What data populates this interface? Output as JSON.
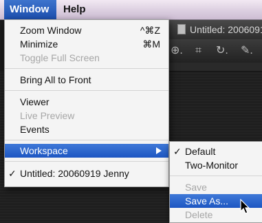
{
  "menubar": {
    "items": [
      {
        "label": "Window"
      },
      {
        "label": "Help"
      }
    ]
  },
  "background_window": {
    "title": "Untitled: 2006091",
    "toolbar_icons": [
      "zoom-icon",
      "crop-icon",
      "rotate-icon",
      "brush-icon"
    ],
    "toolbar_glyphs": [
      "⊕.",
      "⌗",
      "↻.",
      "✎."
    ]
  },
  "window_menu": {
    "items": [
      {
        "label": "Zoom Window",
        "shortcut": "^⌘Z",
        "enabled": true
      },
      {
        "label": "Minimize",
        "shortcut": "⌘M",
        "enabled": true
      },
      {
        "label": "Toggle Full Screen",
        "shortcut": "",
        "enabled": false
      },
      {
        "label": "Bring All to Front",
        "shortcut": "",
        "enabled": true
      },
      {
        "label": "Viewer",
        "shortcut": "",
        "enabled": true
      },
      {
        "label": "Live Preview",
        "shortcut": "",
        "enabled": false
      },
      {
        "label": "Events",
        "shortcut": "",
        "enabled": true
      },
      {
        "label": "Workspace",
        "shortcut": "",
        "enabled": true,
        "highlighted": true,
        "has_submenu": true
      },
      {
        "label": "Untitled: 20060919 Jenny",
        "shortcut": "",
        "enabled": true,
        "checked": true,
        "check_mark": "✓"
      }
    ]
  },
  "workspace_submenu": {
    "items": [
      {
        "label": "Default",
        "checked": true,
        "check_mark": "✓",
        "enabled": true
      },
      {
        "label": "Two-Monitor",
        "enabled": true
      },
      {
        "label": "Save",
        "enabled": false
      },
      {
        "label": "Save As...",
        "enabled": true,
        "highlighted": true
      },
      {
        "label": "Delete",
        "enabled": false
      }
    ]
  },
  "colors": {
    "highlight": "#1d56c2",
    "menu_background": "#f4f4f4",
    "disabled_text": "#a6a6a6"
  }
}
